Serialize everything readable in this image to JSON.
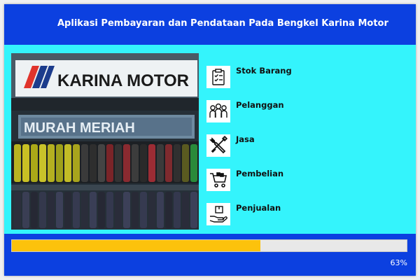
{
  "header": {
    "title": "Aplikasi Pembayaran dan Pendataan Pada Bengkel Karina Motor"
  },
  "photo": {
    "sign_text": "KARINA MOTOR",
    "banner_text": "MURAH MERIAH"
  },
  "menu": {
    "items": [
      {
        "label": "Stok Barang",
        "icon": "clipboard-checklist-icon"
      },
      {
        "label": "Pelanggan",
        "icon": "people-group-icon"
      },
      {
        "label": "Jasa",
        "icon": "wrench-screwdriver-icon"
      },
      {
        "label": "Pembelian",
        "icon": "shopping-cart-icon"
      },
      {
        "label": "Penjualan",
        "icon": "hand-box-icon"
      }
    ]
  },
  "progress": {
    "value": 0.63,
    "label": "63%"
  },
  "colors": {
    "header": "#0c40e0",
    "content": "#34f4fc",
    "progress_fill": "#fcc20c",
    "progress_track": "#e8e8e8"
  }
}
